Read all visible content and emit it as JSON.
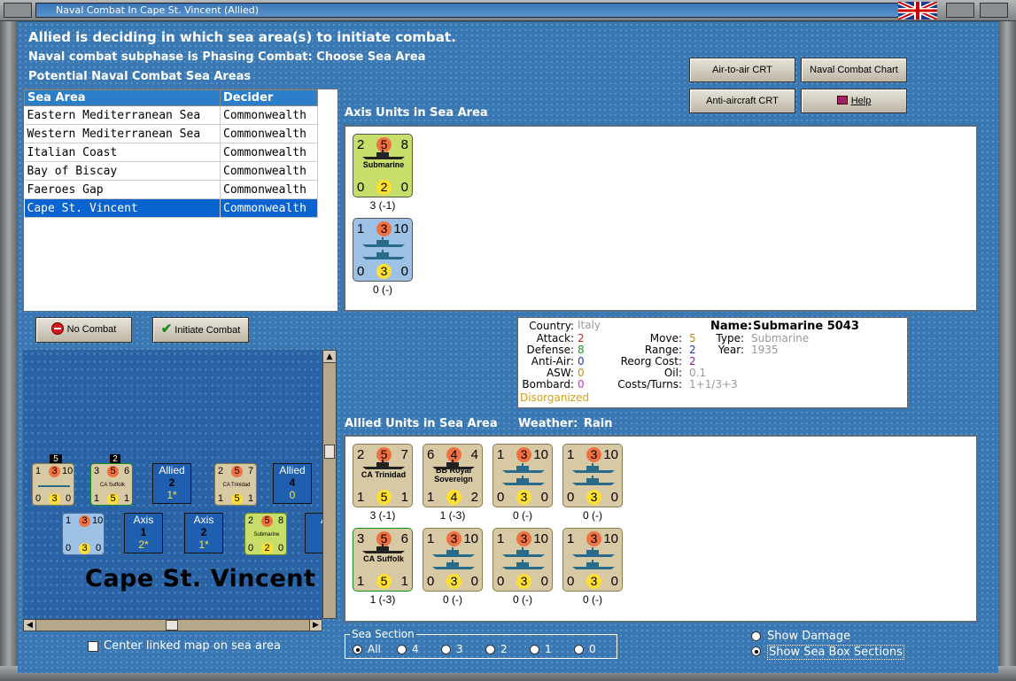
{
  "window": {
    "title": "Naval Combat In Cape St. Vincent (Allied)"
  },
  "header": {
    "line1": "Allied is deciding in which sea area(s) to initiate combat.",
    "line2": "Naval combat subphase is Phasing Combat: Choose Sea Area",
    "line3": "Potential Naval Combat Sea Areas"
  },
  "buttons": {
    "air_to_air": "Air-to-air CRT",
    "naval_chart": "Naval Combat Chart",
    "anti_aircraft": "Anti-aircraft CRT",
    "help": "Help",
    "no_combat": "No Combat",
    "initiate_combat": "Initiate Combat"
  },
  "sea_table": {
    "headers": [
      "Sea Area",
      "Decider"
    ],
    "rows": [
      [
        "Eastern Mediterranean Sea",
        "Commonwealth"
      ],
      [
        "Western Mediterranean Sea",
        "Commonwealth"
      ],
      [
        "Italian Coast",
        "Commonwealth"
      ],
      [
        "Bay of Biscay",
        "Commonwealth"
      ],
      [
        "Faeroes Gap",
        "Commonwealth"
      ],
      [
        "Cape St. Vincent",
        "Commonwealth"
      ]
    ],
    "selected_index": 5
  },
  "axis": {
    "label": "Axis Units in Sea Area",
    "units": [
      {
        "tl": "2",
        "tc": "5",
        "tr": "8",
        "name": "Submarine",
        "bl": "0",
        "bc": "2",
        "br": "0",
        "status": "3 (-1)",
        "color": "#c8de6a"
      },
      {
        "tl": "1",
        "tc": "3",
        "tr": "10",
        "name": "",
        "bl": "0",
        "bc": "3",
        "br": "0",
        "status": "0 (-)",
        "color": "#9ec1e6"
      }
    ]
  },
  "info": {
    "country_l": "Country:",
    "country": "Italy",
    "attack_l": "Attack:",
    "attack": "2",
    "defense_l": "Defense:",
    "defense": "8",
    "antiair_l": "Anti-Air:",
    "antiair": "0",
    "asw_l": "ASW:",
    "asw": "0",
    "bombard_l": "Bombard:",
    "bombard": "0",
    "status": "Disorganized",
    "move_l": "Move:",
    "move": "5",
    "range_l": "Range:",
    "range": "2",
    "reorg_l": "Reorg Cost:",
    "reorg": "2",
    "oil_l": "Oil:",
    "oil": "0.1",
    "costs_l": "Costs/Turns:",
    "costs": "1+1/3+3",
    "name_l": "Name:",
    "name": "Submarine 5043",
    "type_l": "Type:",
    "type": "Submarine",
    "year_l": "Year:",
    "year": "1935"
  },
  "allied": {
    "label": "Allied Units in Sea Area",
    "weather_label": "Weather:",
    "weather": "Rain",
    "row1": [
      {
        "tl": "2",
        "tc": "5",
        "tr": "7",
        "name": "CA Trinidad",
        "bl": "1",
        "bc": "5",
        "br": "1",
        "status": "3 (-1)"
      },
      {
        "tl": "6",
        "tc": "4",
        "tr": "4",
        "name": "BB Royal Sovereign",
        "bl": "1",
        "bc": "4",
        "br": "2",
        "status": "1 (-3)"
      },
      {
        "tl": "1",
        "tc": "3",
        "tr": "10",
        "name": "",
        "bl": "0",
        "bc": "3",
        "br": "0",
        "status": "0 (-)"
      },
      {
        "tl": "1",
        "tc": "3",
        "tr": "10",
        "name": "",
        "bl": "0",
        "bc": "3",
        "br": "0",
        "status": "0 (-)"
      }
    ],
    "row2": [
      {
        "tl": "3",
        "tc": "5",
        "tr": "6",
        "name": "CA Suffolk",
        "bl": "1",
        "bc": "5",
        "br": "1",
        "status": "1 (-3)"
      },
      {
        "tl": "1",
        "tc": "3",
        "tr": "10",
        "name": "",
        "bl": "0",
        "bc": "3",
        "br": "0",
        "status": "0 (-)"
      },
      {
        "tl": "1",
        "tc": "3",
        "tr": "10",
        "name": "",
        "bl": "0",
        "bc": "3",
        "br": "0",
        "status": "0 (-)"
      },
      {
        "tl": "1",
        "tc": "3",
        "tr": "10",
        "name": "",
        "bl": "0",
        "bc": "3",
        "br": "0",
        "status": "0 (-)"
      }
    ]
  },
  "map": {
    "title": "Cape St. Vincent",
    "stack1_count": "5",
    "stack2_count": "2",
    "allied_box1": {
      "label": "Allied",
      "num": "2",
      "sub": "1*"
    },
    "allied_box2": {
      "label": "Allied",
      "num": "4",
      "sub": "0"
    },
    "axis_box1": {
      "label": "Axis",
      "num": "1",
      "sub": "2*"
    },
    "axis_box2": {
      "label": "Axis",
      "num": "2",
      "sub": "1*"
    },
    "axis_box3": {
      "label": "A"
    },
    "mini_ca_suffolk": "CA Suffolk",
    "mini_ca_trinidad": "CA Trinidad",
    "mini_sub": "Submarine"
  },
  "center_map_label": "Center linked map on sea area",
  "sea_section": {
    "label": "Sea Section",
    "options": [
      "All",
      "4",
      "3",
      "2",
      "1",
      "0"
    ],
    "selected": "All"
  },
  "show_damage": "Show Damage",
  "show_sea_box": "Show Sea Box Sections",
  "colors": {
    "background": "#3a78b4",
    "table_header": "#2c7ec8",
    "selected_row": "#0a64d0",
    "counter_tan": "#d7c9a4"
  }
}
